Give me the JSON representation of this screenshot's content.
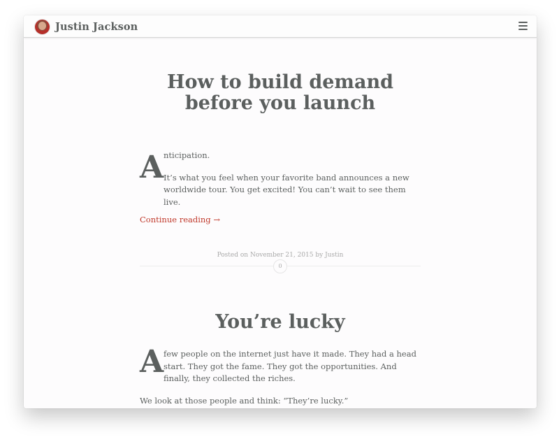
{
  "header": {
    "site_name": "Justin Jackson",
    "avatar_icon": "avatar-photo",
    "menu_icon": "hamburger-menu-icon"
  },
  "posts": [
    {
      "title": "How to build demand before you launch",
      "dropcap": "A",
      "first_line": "nticipation.",
      "paragraph2": "It’s what you feel when your favorite band announces a new worldwide tour. You get excited! You can’t wait to see them live.",
      "continue_link": "Continue reading →",
      "meta_prefix": "Posted on ",
      "meta_date": "November 21, 2015",
      "meta_by": " by ",
      "meta_author": "Justin",
      "comment_count": "0"
    },
    {
      "title": "You’re lucky",
      "dropcap": "A",
      "first_paragraph": "few people on the internet just have it made. They had a head start. They got the fame. They got the opportunities. And finally, they collected the riches.",
      "paragraph2": "We look at those people and think: “They’re lucky.”"
    }
  ],
  "colors": {
    "accent": "#c0392b",
    "text": "#5b5f5e",
    "meta": "#a9a9a9"
  }
}
